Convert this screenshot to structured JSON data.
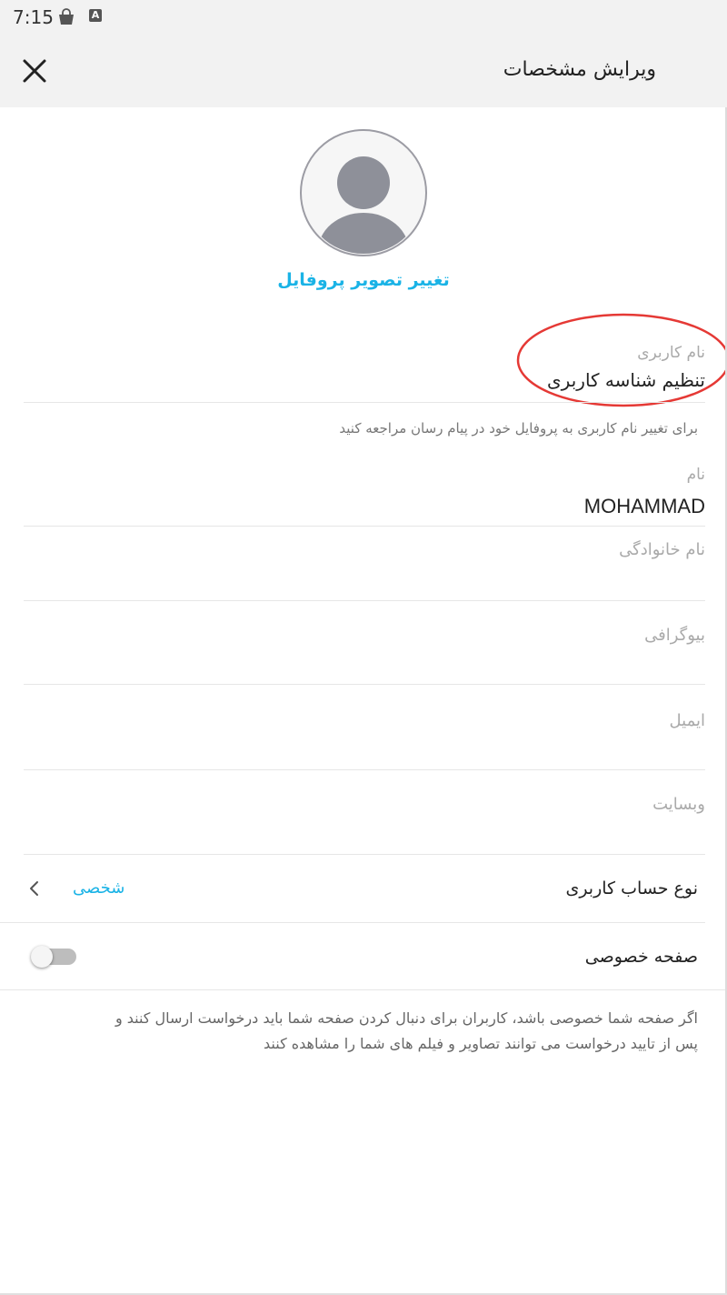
{
  "status_bar": {
    "time": "7:15",
    "icons": [
      "shopping-bag-icon",
      "app-store-icon"
    ],
    "badge_letter": "A"
  },
  "header": {
    "title": "ویرایش مشخصات",
    "close_icon": "close-icon"
  },
  "profile": {
    "avatar_icon": "person-icon",
    "change_photo_label": "تغییر تصویر پروفایل"
  },
  "form": {
    "username": {
      "label": "نام کاربری",
      "value": "تنظیم شناسه کاربری",
      "hint": "برای تغییر نام کاربری به پروفایل خود در پیام رسان مراجعه کنید"
    },
    "first_name": {
      "label": "نام",
      "value": "MOHAMMAD"
    },
    "last_name": {
      "placeholder": "نام خانوادگی"
    },
    "bio": {
      "placeholder": "بیوگرافی"
    },
    "email": {
      "placeholder": "ایمیل"
    },
    "website": {
      "placeholder": "وبسایت"
    }
  },
  "account_type": {
    "label": "نوع حساب کاربری",
    "value": "شخصی"
  },
  "private_page": {
    "label": "صفحه خصوصی",
    "enabled": false,
    "hint_line1": "اگر صفحه شما خصوصی باشد، کاربران برای دنبال کردن صفحه شما باید درخواست ارسال کنند و",
    "hint_line2": "پس از تایید درخواست می توانند تصاویر و فیلم های شما را مشاهده کنند"
  },
  "colors": {
    "accent": "#1ab3e6",
    "annotation": "#e53935",
    "header_bg": "#f2f2f2",
    "avatar_gray": "#8e9099"
  }
}
